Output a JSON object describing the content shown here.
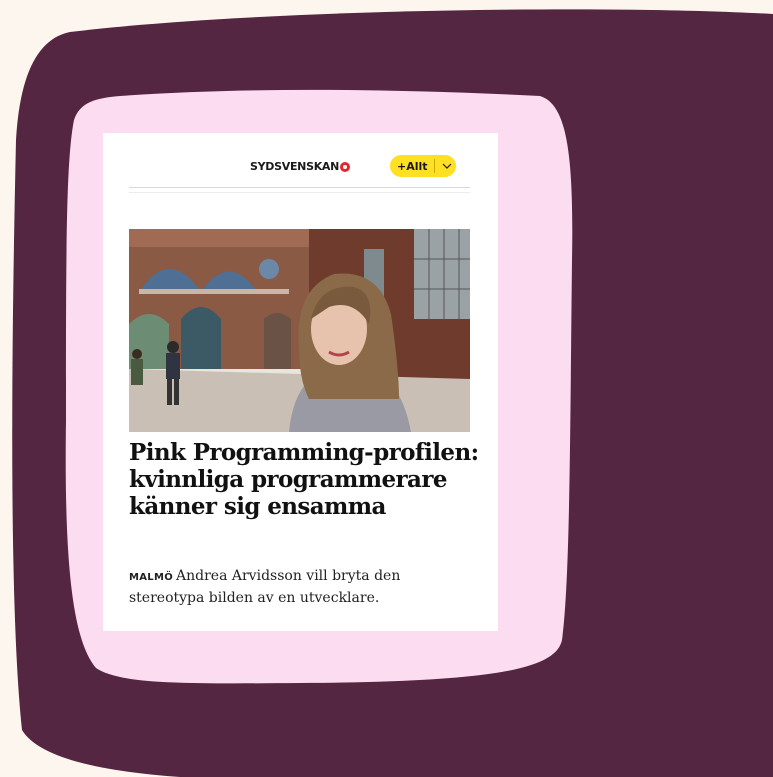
{
  "colors": {
    "background": "#fdf6ee",
    "outer_blob": "#552642",
    "inner_blob": "#fcdcf1",
    "accent_yellow": "#ffe022",
    "logo_red": "#e3262e"
  },
  "header": {
    "logo_text": "SYDSVENSKAN",
    "logo_icon": "sydsvenskan-dot-icon",
    "menu_button_label": "+Allt",
    "menu_button_icon": "chevron-down-icon"
  },
  "article": {
    "image_description_icon": "article-photo",
    "headline": "Pink Programming-profilen: kvinnliga programmerare känner sig ensamma",
    "dateline": "MALMÖ",
    "lead": "Andrea Arvidsson vill bryta den stereotypa bilden av en utvecklare."
  }
}
